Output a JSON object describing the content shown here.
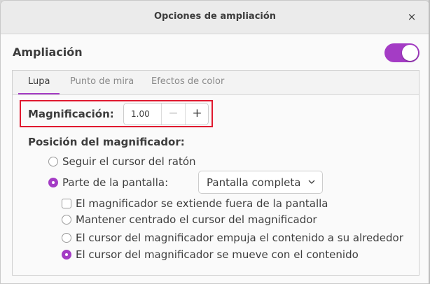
{
  "dialog": {
    "title": "Opciones de ampliación",
    "close_glyph": "×"
  },
  "ampliacion": {
    "label": "Ampliación",
    "enabled": true
  },
  "tabs": [
    {
      "label": "Lupa",
      "active": true
    },
    {
      "label": "Punto de mira",
      "active": false
    },
    {
      "label": "Efectos de color",
      "active": false
    }
  ],
  "magnification": {
    "label": "Magnificación:",
    "value": "1.00",
    "minus": "−",
    "plus": "+"
  },
  "position": {
    "heading": "Posición del magnificador:",
    "follow_mouse": {
      "label": "Seguir el cursor del ratón",
      "checked": false
    },
    "part_of_screen": {
      "label": "Parte de la pantalla:",
      "checked": true
    },
    "screen_part_select": {
      "value": "Pantalla completa"
    },
    "extends_outside": {
      "label": "El magnificador se extiende fuera de la pantalla",
      "checked": false
    },
    "keep_centered": {
      "label": "Mantener centrado el cursor del magnificador",
      "checked": false
    },
    "push_content": {
      "label": "El cursor del magnificador empuja el contenido a su alrededor",
      "checked": false
    },
    "move_with_content": {
      "label": "El cursor del magnificador se mueve con el contenido",
      "checked": true
    }
  },
  "colors": {
    "accent": "#a43cc5",
    "highlight": "#e0192f"
  },
  "icons": {
    "close": "close-icon",
    "dropdown": "chevron-down-icon"
  }
}
